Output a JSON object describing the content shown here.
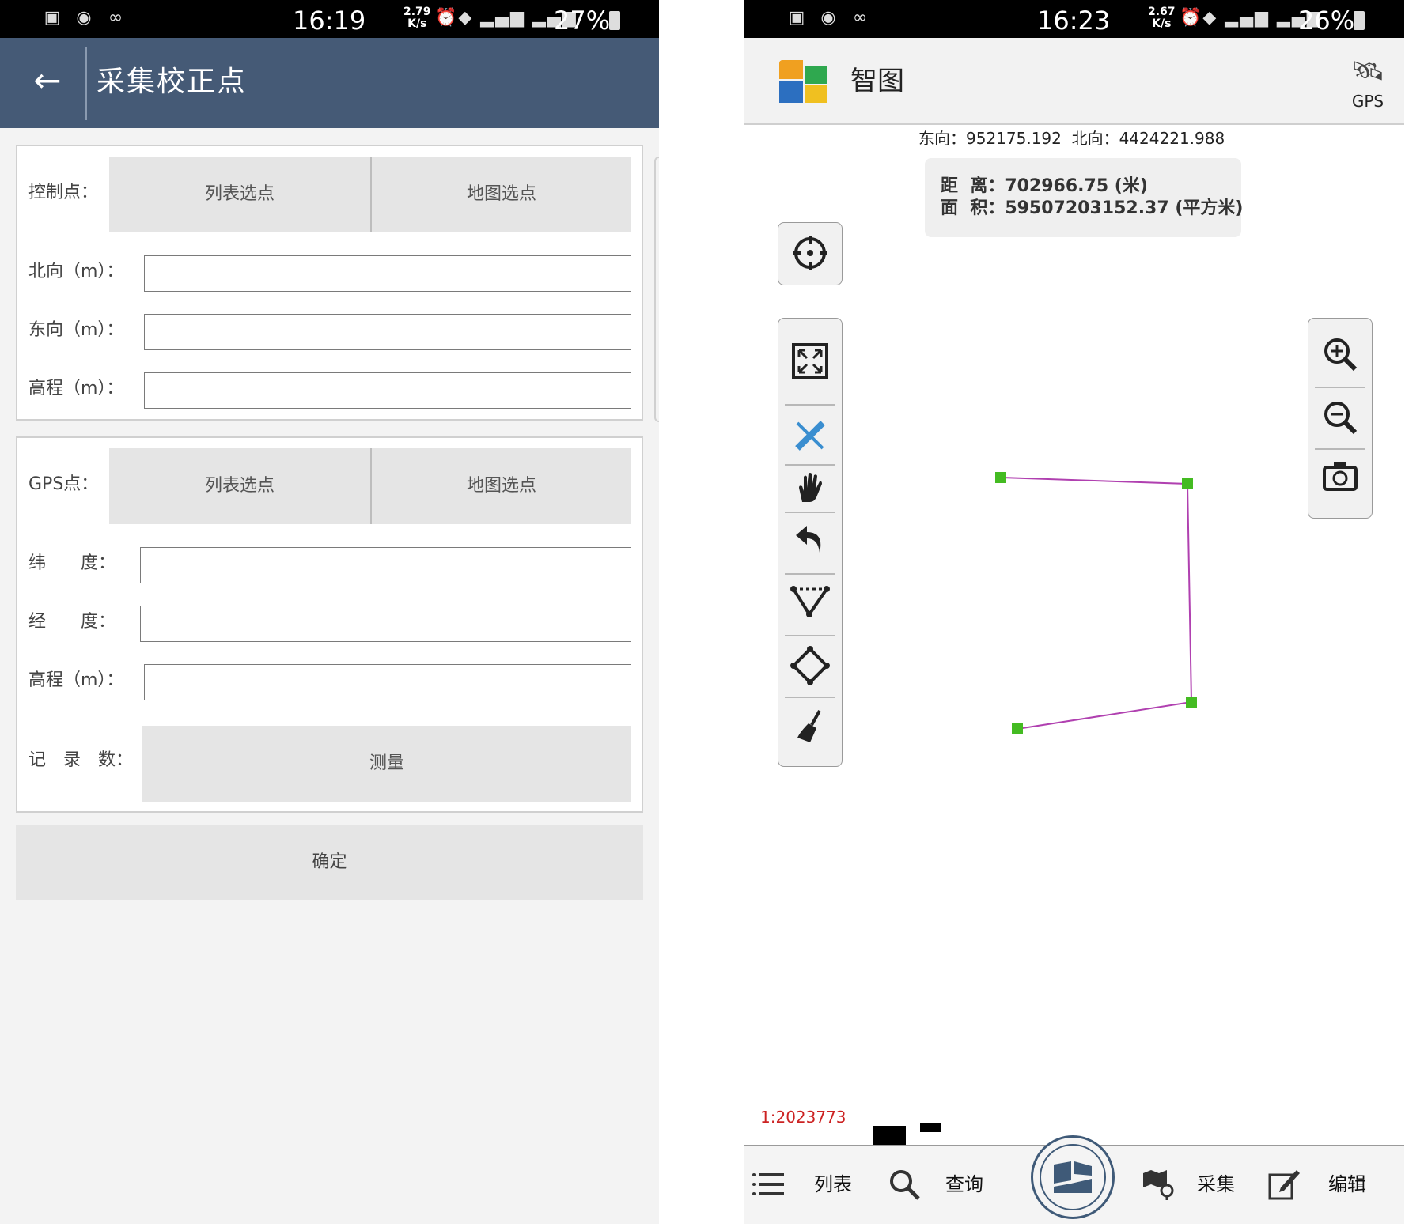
{
  "left": {
    "status": {
      "time": "16:19",
      "rate_top": "2.79",
      "rate_bottom": "K/s",
      "battery": "27%"
    },
    "title": "采集校正点",
    "control": {
      "label": "控制点：",
      "btn_list": "列表选点",
      "btn_map": "地图选点",
      "north_label": "北向（m）：",
      "east_label": "东向（m）：",
      "elev_label": "高程（m）："
    },
    "gps": {
      "label": "GPS点：",
      "btn_list": "列表选点",
      "btn_map": "地图选点",
      "lat_label": "纬　　度：",
      "lon_label": "经　　度：",
      "elev_label": "高程（m）：",
      "records_label": "记　录　数：",
      "measure_btn": "测量"
    },
    "confirm": "确定"
  },
  "right": {
    "status": {
      "time": "16:23",
      "rate_top": "2.67",
      "rate_bottom": "K/s",
      "battery": "26%"
    },
    "app_name": "智图",
    "gps_label": "GPS",
    "coords": "东向：952175.192  北向：4424221.988",
    "measure": {
      "distance": "距  离：702966.75 (米)",
      "area": "面  积：59507203152.37 (平方米)"
    },
    "scale": "1:2023773",
    "nav": {
      "list": "列表",
      "query": "查询",
      "collect": "采集",
      "edit": "编辑"
    },
    "colors": {
      "line": "#b040b0",
      "vertex": "#44bb22"
    }
  }
}
